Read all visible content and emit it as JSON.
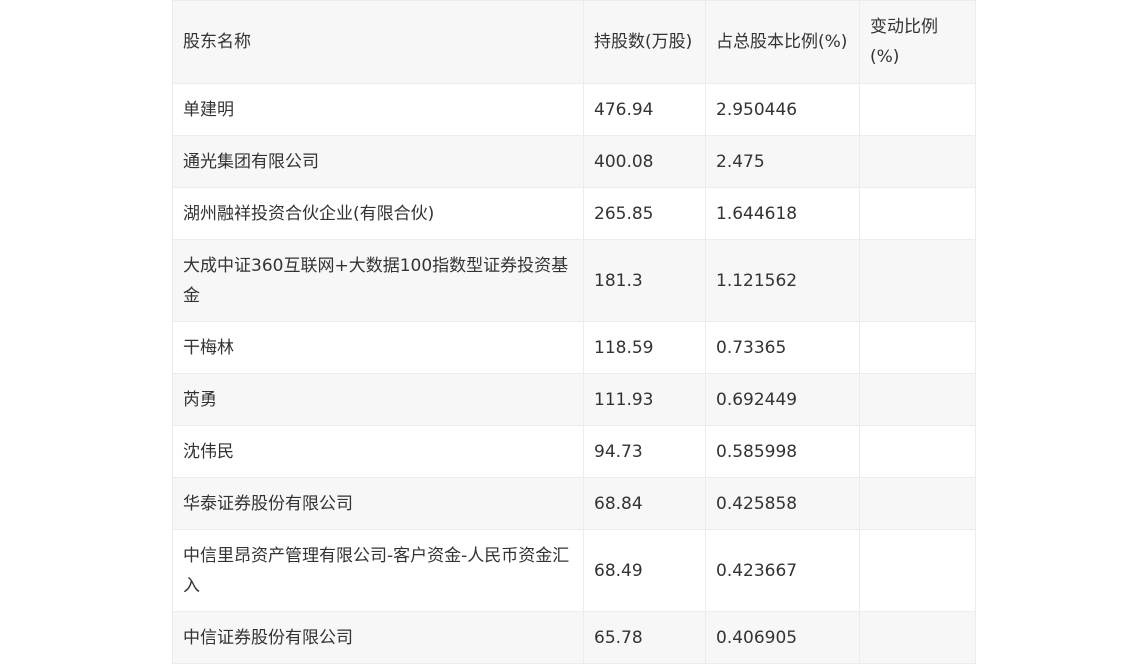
{
  "table": {
    "headers": [
      "股东名称",
      "持股数(万股)",
      "占总股本比例(%)",
      "变动比例(%)"
    ],
    "rows": [
      [
        "单建明",
        "476.94",
        "2.950446",
        ""
      ],
      [
        "通光集团有限公司",
        "400.08",
        "2.475",
        ""
      ],
      [
        "湖州融祥投资合伙企业(有限合伙)",
        "265.85",
        "1.644618",
        ""
      ],
      [
        "大成中证360互联网+大数据100指数型证券投资基金",
        "181.3",
        "1.121562",
        ""
      ],
      [
        "干梅林",
        "118.59",
        "0.73365",
        ""
      ],
      [
        "芮勇",
        "111.93",
        "0.692449",
        ""
      ],
      [
        "沈伟民",
        "94.73",
        "0.585998",
        ""
      ],
      [
        "华泰证券股份有限公司",
        "68.84",
        "0.425858",
        ""
      ],
      [
        "中信里昂资产管理有限公司-客户资金-人民币资金汇入",
        "68.49",
        "0.423667",
        ""
      ],
      [
        "中信证券股份有限公司",
        "65.78",
        "0.406905",
        ""
      ]
    ]
  }
}
